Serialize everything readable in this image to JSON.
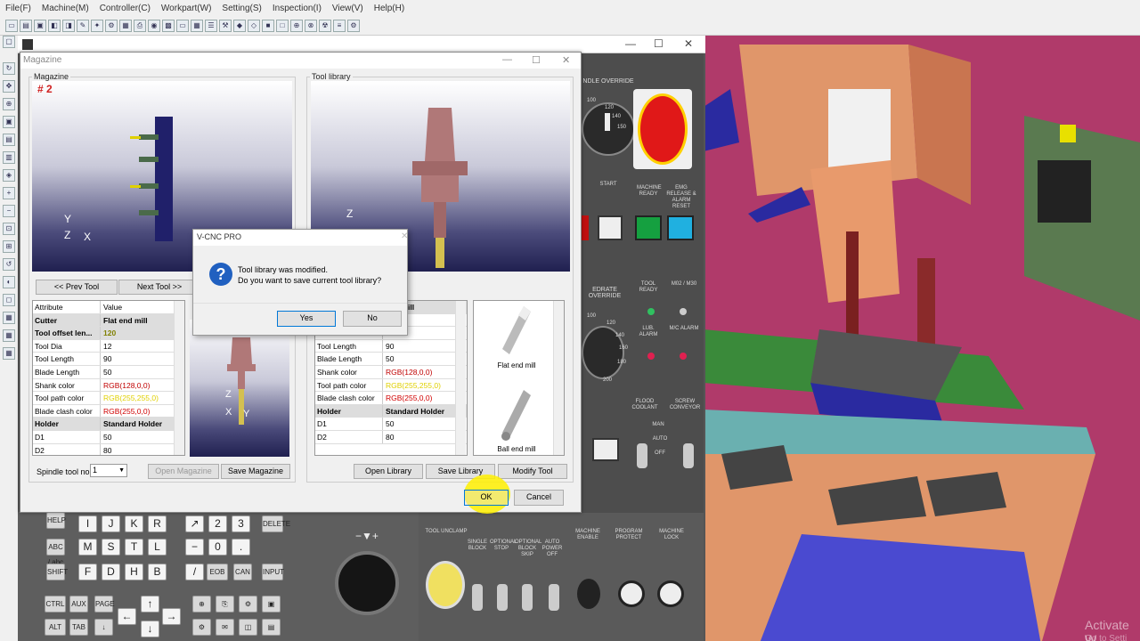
{
  "menu": [
    "File(F)",
    "Machine(M)",
    "Controller(C)",
    "Workpart(W)",
    "Setting(S)",
    "Inspection(I)",
    "View(V)",
    "Help(H)"
  ],
  "magazine_window": {
    "title": "Magazine",
    "magazine_group": "Magazine",
    "magazine_number": "# 2",
    "tool_library_group": "Tool library",
    "prev_tool": "<< Prev Tool",
    "next_tool": "Next Tool >>",
    "table_header": {
      "attr": "Attribute",
      "value": "Value"
    },
    "rows": [
      {
        "attr": "Cutter",
        "value": "Flat end mill",
        "bold": true
      },
      {
        "attr": "Tool offset len...",
        "value": "120",
        "bold": true,
        "color": "#808000"
      },
      {
        "attr": "Tool Dia",
        "value": "12"
      },
      {
        "attr": "Tool Length",
        "value": "90"
      },
      {
        "attr": "Blade Length",
        "value": "50"
      },
      {
        "attr": "Shank color",
        "value": "RGB(128,0,0)",
        "color": "#c00000"
      },
      {
        "attr": "Tool path color",
        "value": "RGB(255,255,0)",
        "color": "#e0d000"
      },
      {
        "attr": "Blade clash color",
        "value": "RGB(255,0,0)",
        "color": "#d00000"
      },
      {
        "attr": "Holder",
        "value": "Standard Holder",
        "bold": true
      },
      {
        "attr": "D1",
        "value": "50"
      },
      {
        "attr": "D2",
        "value": "80"
      }
    ],
    "lib_rows": [
      {
        "attr": "",
        "value": "end mill",
        "bold": true
      },
      {
        "attr": "",
        "value": ""
      },
      {
        "attr": "Tool Dia",
        "value": "12"
      },
      {
        "attr": "Tool Length",
        "value": "90"
      },
      {
        "attr": "Blade Length",
        "value": "50"
      },
      {
        "attr": "Shank color",
        "value": "RGB(128,0,0)",
        "color": "#c00000"
      },
      {
        "attr": "Tool path color",
        "value": "RGB(255,255,0)",
        "color": "#e0d000"
      },
      {
        "attr": "Blade clash color",
        "value": "RGB(255,0,0)",
        "color": "#d00000"
      },
      {
        "attr": "Holder",
        "value": "Standard Holder",
        "bold": true
      },
      {
        "attr": "D1",
        "value": "50"
      },
      {
        "attr": "D2",
        "value": "80"
      }
    ],
    "tool_types": [
      "Flat end mill",
      "Ball end mill"
    ],
    "spindle_label": "Spindle tool no.",
    "spindle_value": "1",
    "open_magazine": "Open Magazine",
    "save_magazine": "Save Magazine",
    "open_library": "Open Library",
    "save_library": "Save Library",
    "modify_tool": "Modify Tool",
    "ok": "OK",
    "cancel": "Cancel"
  },
  "message_box": {
    "title": "V-CNC PRO",
    "line1": "Tool library was modified.",
    "line2": "Do you want to save current tool library?",
    "yes": "Yes",
    "no": "No"
  },
  "operator_panel": {
    "spindle_override": "NDLE OVERRIDE",
    "feedrate_override": "EDRATE OVERRIDE",
    "start": "START",
    "machine_ready": "MACHINE READY",
    "emg_release": "EMG RELEASE & ALARM RESET",
    "tool_ready": "TOOL READY",
    "m02_m30": "M02 / M30",
    "lub_alarm": "LUB. ALARM",
    "mc_alarm": "M/C ALARM",
    "flood_coolant": "FLOOD COOLANT",
    "screw_conveyor": "SCREW CONVEYOR",
    "man": "MAN",
    "auto": "AUTO",
    "off": "OFF",
    "tool_unclamp": "TOOL UNCLAMP",
    "single_block": "SINGLE BLOCK",
    "optional_stop": "OPTIONAL STOP",
    "optional_block_skip": "OPTIONAL BLOCK SKIP",
    "auto_power_off": "AUTO POWER OFF",
    "machine_enable": "MACHINE ENABLE",
    "program_protect": "PROGRAM PROTECT",
    "machine_lock": "MACHINE LOCK",
    "scale_spindle": [
      "100",
      "120",
      "140",
      "150"
    ],
    "scale_feed": [
      "100",
      "120",
      "140",
      "160",
      "180",
      "200"
    ]
  },
  "keyboard": {
    "help": "HELP",
    "abc": "ABC / abc",
    "shift": "SHIFT",
    "ctrl": "CTRL",
    "aux": "AUX",
    "alt": "ALT",
    "tab": "TAB",
    "delete": "DELETE",
    "input": "INPUT",
    "eob": "EOB",
    "can": "CAN",
    "page": "PAGE",
    "keys": [
      "I",
      "J",
      "K",
      "R",
      "M",
      "S",
      "T",
      "L",
      "F",
      "D",
      "H",
      "B",
      "2",
      "3",
      "0",
      "/"
    ]
  },
  "watermark": {
    "line1": "Activate W",
    "line2": "Go to Setti"
  }
}
